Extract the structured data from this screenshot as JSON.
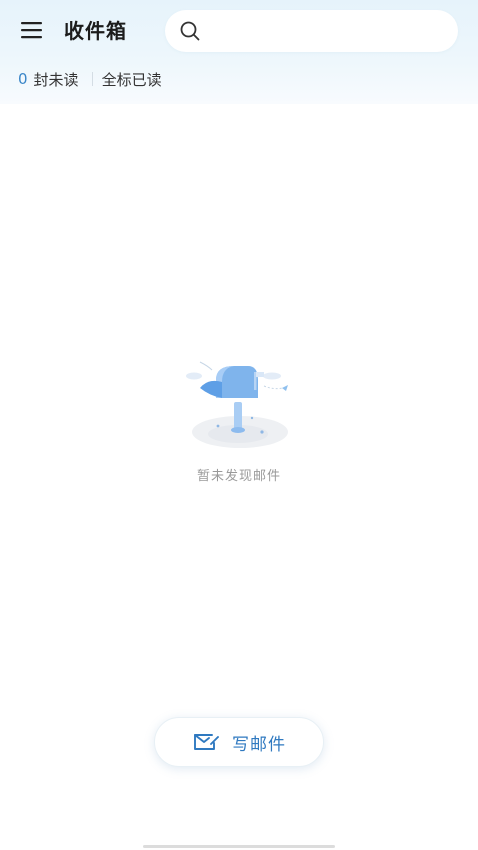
{
  "header": {
    "title": "收件箱",
    "search_placeholder": "",
    "search_value": ""
  },
  "status": {
    "unread_count": "0",
    "unread_label": "封未读",
    "mark_all_read": "全标已读"
  },
  "empty_state": {
    "message": "暂未发现邮件"
  },
  "compose": {
    "label": "写邮件"
  },
  "icons": {
    "menu": "menu-icon",
    "search": "search-icon",
    "compose": "mail-edit-icon",
    "empty": "mailbox-illustration"
  },
  "colors": {
    "accent": "#2f79c0",
    "unread": "#3a86c8",
    "header_bg": "#e6f3fb",
    "illustration": "#7fb4ec"
  }
}
